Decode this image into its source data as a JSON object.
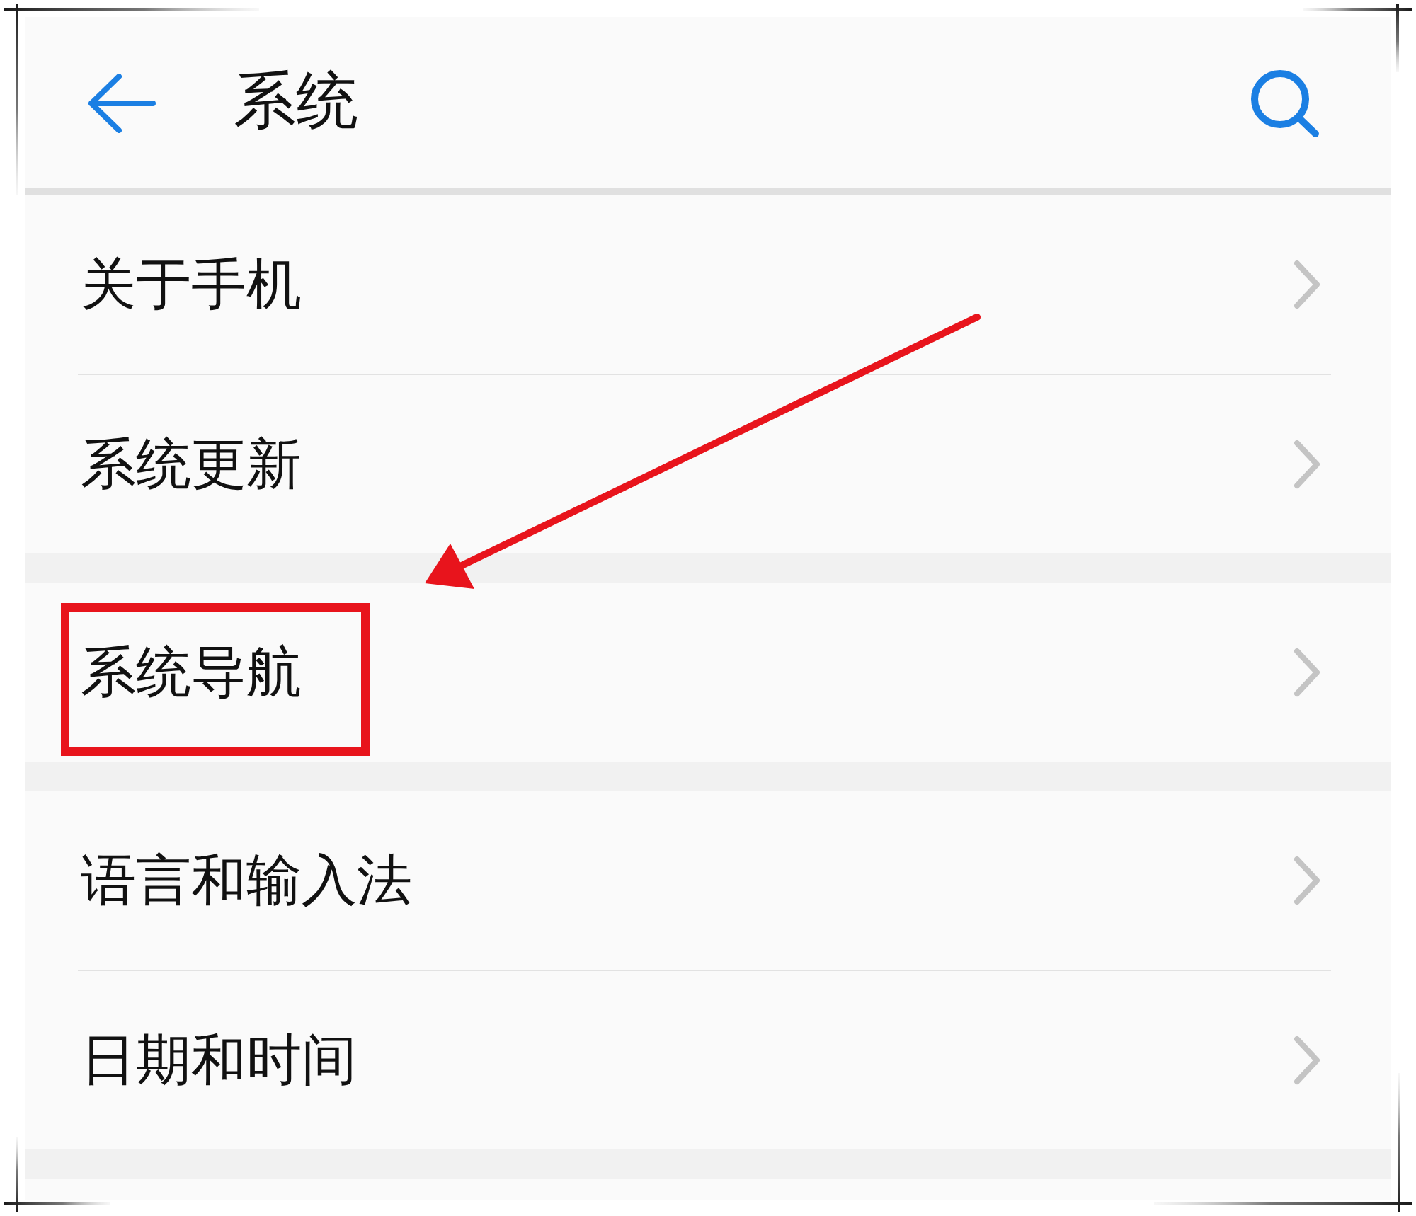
{
  "header": {
    "title": "系统"
  },
  "groups": [
    {
      "items": [
        {
          "label": "关于手机",
          "highlighted": false
        },
        {
          "label": "系统更新",
          "highlighted": false
        }
      ]
    },
    {
      "items": [
        {
          "label": "系统导航",
          "highlighted": true
        }
      ]
    },
    {
      "items": [
        {
          "label": "语言和输入法",
          "highlighted": false
        },
        {
          "label": "日期和时间",
          "highlighted": false
        }
      ]
    }
  ]
}
